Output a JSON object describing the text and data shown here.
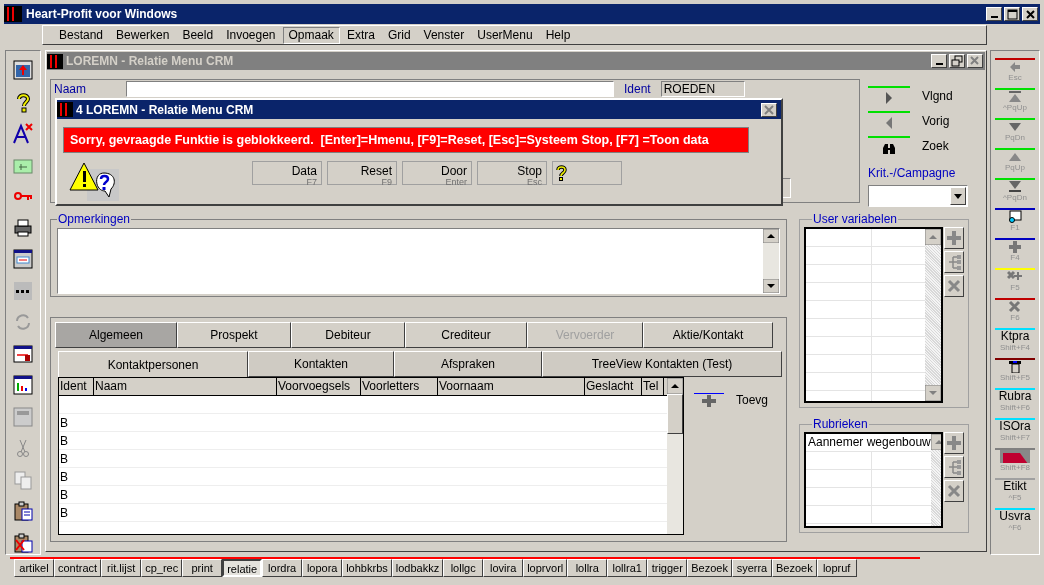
{
  "window": {
    "title": "Heart-Profit voor Windows"
  },
  "menu": [
    {
      "label": "Bestand",
      "selected": false
    },
    {
      "label": "Bewerken",
      "selected": false
    },
    {
      "label": "Beeld",
      "selected": false
    },
    {
      "label": "Invoegen",
      "selected": false
    },
    {
      "label": "Opmaak",
      "selected": true
    },
    {
      "label": "Extra",
      "selected": false
    },
    {
      "label": "Grid",
      "selected": false
    },
    {
      "label": "Venster",
      "selected": false
    },
    {
      "label": "UserMenu",
      "selected": false
    },
    {
      "label": "Help",
      "selected": false
    }
  ],
  "child_window": {
    "title": "LOREMN - Relatie Menu CRM",
    "form": {
      "name_label": "Naam",
      "ident_label": "Ident",
      "ident_value": "ROEDEN"
    },
    "navigation": [
      {
        "label": "Vlgnd"
      },
      {
        "label": "Vorig"
      },
      {
        "label": "Zoek"
      }
    ],
    "criteria": {
      "label": "Krit.-/Campagne"
    },
    "remarks": {
      "label": "Opmerkingen"
    },
    "tabs": [
      {
        "label": "Algemeen",
        "selected": true,
        "disabled": false
      },
      {
        "label": "Prospekt",
        "selected": false,
        "disabled": false
      },
      {
        "label": "Debiteur",
        "selected": false,
        "disabled": false
      },
      {
        "label": "Crediteur",
        "selected": false,
        "disabled": false
      },
      {
        "label": "Vervoerder",
        "selected": false,
        "disabled": true
      },
      {
        "label": "Aktie/Kontakt",
        "selected": false,
        "disabled": false
      }
    ],
    "subtabs": [
      {
        "label": "Kontaktpersonen",
        "selected": true
      },
      {
        "label": "Kontakten",
        "selected": false
      },
      {
        "label": "Afspraken",
        "selected": false
      },
      {
        "label": "TreeView Kontakten (Test)",
        "selected": false
      }
    ],
    "table": {
      "columns": [
        "Ident",
        "Naam",
        "Voorvoegsels",
        "Voorletters",
        "Voornaam",
        "Geslacht",
        "Tel"
      ],
      "rows": [
        {
          "ident": "B"
        },
        {
          "ident": "B"
        },
        {
          "ident": "B"
        },
        {
          "ident": "B"
        },
        {
          "ident": "B"
        },
        {
          "ident": "B"
        }
      ]
    },
    "add_button": {
      "label": "Toevg"
    },
    "user_variables": {
      "label": "User variabelen"
    },
    "categories": {
      "label": "Rubrieken",
      "items": [
        "Aannemer wegenbouw"
      ]
    }
  },
  "dialog": {
    "title": "4 LOREMN - Relatie Menu CRM",
    "message": "Sorry, gevraagde Funktie is geblokkeerd.  [Enter]=Hmenu, [F9]=Reset, [Esc]=Systeem Stop, [F7] =Toon data",
    "buttons": [
      {
        "label": "Data",
        "key": "F7"
      },
      {
        "label": "Reset",
        "key": "F9"
      },
      {
        "label": "Door",
        "key": "Enter"
      },
      {
        "label": "Stop",
        "key": "Esc"
      }
    ]
  },
  "right_toolbar": [
    {
      "kind": "icon",
      "key": "Esc",
      "color": "#c00000"
    },
    {
      "kind": "icon",
      "key": "^PqUp",
      "color": "#00e000"
    },
    {
      "kind": "icon",
      "key": "PqDn",
      "color": "#00e000"
    },
    {
      "kind": "icon",
      "key": "PqUp",
      "color": "#00e000"
    },
    {
      "kind": "icon",
      "key": "^PqDn",
      "color": "#00e000"
    },
    {
      "kind": "icon",
      "key": "F1",
      "color": "#0000c0"
    },
    {
      "kind": "icon",
      "key": "F4",
      "color": "#0000c0"
    },
    {
      "kind": "icon",
      "key": "F5",
      "color": "#ffff00"
    },
    {
      "kind": "icon",
      "key": "F6",
      "color": "#c00000"
    },
    {
      "kind": "text",
      "label": "Ktpra",
      "key": "Shift+F4",
      "color": "#00e0ff"
    },
    {
      "kind": "icon",
      "key": "Shift+F5",
      "color": "#800000"
    },
    {
      "kind": "text",
      "label": "Rubra",
      "key": "Shift+F6",
      "color": "#00e0ff"
    },
    {
      "kind": "text",
      "label": "ISOra",
      "key": "Shift+F7",
      "color": "#00e0ff"
    },
    {
      "kind": "icon",
      "key": "Shift+F8",
      "color": "#808080"
    },
    {
      "kind": "text",
      "label": "Etikt",
      "key": "^F5",
      "color": "#a0a0a0"
    },
    {
      "kind": "text",
      "label": "Usvra",
      "key": "^F6",
      "color": "#00e0ff"
    }
  ],
  "bottom_tabs": [
    {
      "label": "artikel",
      "selected": false
    },
    {
      "label": "contract",
      "selected": false
    },
    {
      "label": "rit.lijst",
      "selected": false
    },
    {
      "label": "cp_rec",
      "selected": false
    },
    {
      "label": "print",
      "selected": false
    },
    {
      "label": "relatie",
      "selected": true
    },
    {
      "label": "lordra",
      "selected": false
    },
    {
      "label": "lopora",
      "selected": false
    },
    {
      "label": "lohbkrbs",
      "selected": false
    },
    {
      "label": "lodbakkz",
      "selected": false
    },
    {
      "label": "lollgc",
      "selected": false
    },
    {
      "label": "lovira",
      "selected": false
    },
    {
      "label": "loprvorl",
      "selected": false
    },
    {
      "label": "lollra",
      "selected": false
    },
    {
      "label": "lollra1",
      "selected": false
    },
    {
      "label": "trigger",
      "selected": false
    },
    {
      "label": "Bezoek",
      "selected": false
    },
    {
      "label": "syerra",
      "selected": false
    },
    {
      "label": "Bezoek",
      "selected": false
    },
    {
      "label": "lopruf",
      "selected": false
    }
  ]
}
